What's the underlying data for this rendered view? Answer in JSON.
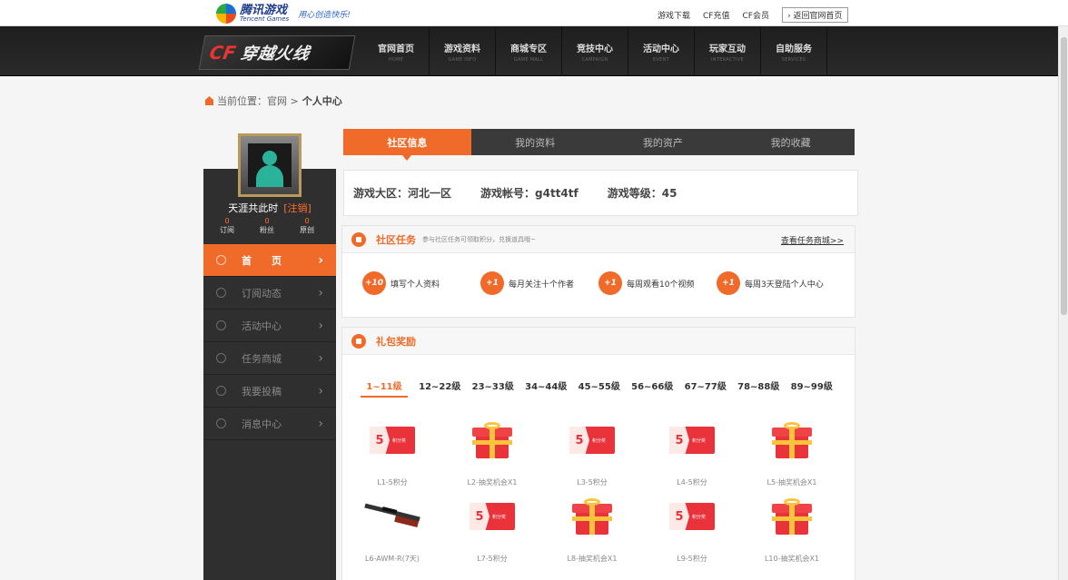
{
  "topbar": {
    "logo_cn": "腾讯游戏",
    "logo_en": "Tencent Games",
    "slogan": "用心创造快乐!",
    "links": [
      "游戏下载",
      "CF充值",
      "CF会员"
    ],
    "back_label": "返回官网首页"
  },
  "nav": {
    "brand_prefix": "CF",
    "brand_name": "穿越火线",
    "items": [
      {
        "cn": "官网首页",
        "en": "HOME"
      },
      {
        "cn": "游戏资料",
        "en": "GAME INFO"
      },
      {
        "cn": "商城专区",
        "en": "GAME MALL"
      },
      {
        "cn": "竞技中心",
        "en": "CAMPAIGN"
      },
      {
        "cn": "活动中心",
        "en": "EVENT"
      },
      {
        "cn": "玩家互动",
        "en": "INTERACTIVE"
      },
      {
        "cn": "自助服务",
        "en": "SERVICES"
      }
    ]
  },
  "breadcrumb": {
    "prefix": "当前位置：官网 >",
    "current": "个人中心"
  },
  "user": {
    "name": "天涯共此时",
    "logout": "[注销]",
    "stats": [
      {
        "value": "0",
        "label": "订阅"
      },
      {
        "value": "0",
        "label": "粉丝"
      },
      {
        "value": "0",
        "label": "原创"
      }
    ]
  },
  "menu": [
    {
      "label": "首　　页"
    },
    {
      "label": "订阅动态"
    },
    {
      "label": "活动中心"
    },
    {
      "label": "任务商城"
    },
    {
      "label": "我要投稿"
    },
    {
      "label": "消息中心"
    }
  ],
  "tabs": [
    "社区信息",
    "我的资料",
    "我的资产",
    "我的收藏"
  ],
  "info": {
    "region": "游戏大区：河北一区",
    "account": "游戏帐号：g4tt4tf",
    "level": "游戏等级：45"
  },
  "tasks": {
    "title": "社区任务",
    "subtitle": "参与社区任务可领取积分，兑换道具哦~",
    "link": "查看任务商城>>",
    "items": [
      {
        "badge": "+10",
        "label": "填写个人资料"
      },
      {
        "badge": "+1",
        "label": "每月关注十个作者"
      },
      {
        "badge": "+1",
        "label": "每周观看10个视频"
      },
      {
        "badge": "+1",
        "label": "每周3天登陆个人中心"
      }
    ]
  },
  "gifts": {
    "title": "礼包奖励",
    "levels": [
      "1~11级",
      "12~22级",
      "23~33级",
      "34~44级",
      "45~55级",
      "56~66级",
      "67~77级",
      "78~88级",
      "89~99级"
    ],
    "points_num": "5",
    "points_label": "积分奖",
    "row1": [
      {
        "type": "points",
        "caption": "L1-5积分"
      },
      {
        "type": "box",
        "caption": "L2-抽奖机会X1"
      },
      {
        "type": "points",
        "caption": "L3-5积分"
      },
      {
        "type": "points",
        "caption": "L4-5积分"
      },
      {
        "type": "box",
        "caption": "L5-抽奖机会X1"
      }
    ],
    "row2": [
      {
        "type": "gun",
        "caption": "L6-AWM-R(7天)"
      },
      {
        "type": "points",
        "caption": "L7-5积分"
      },
      {
        "type": "box",
        "caption": "L8-抽奖机会X1"
      },
      {
        "type": "points",
        "caption": "L9-5积分"
      },
      {
        "type": "box",
        "caption": "L10-抽奖机会X1"
      }
    ]
  }
}
